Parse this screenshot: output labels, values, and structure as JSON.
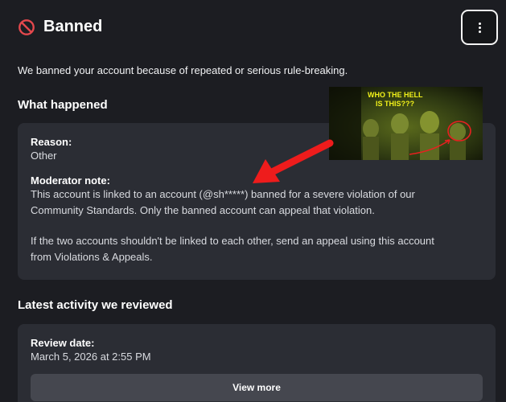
{
  "header": {
    "title": "Banned"
  },
  "intro_text": "We banned your account because of repeated or serious rule-breaking.",
  "what_happened": {
    "heading": "What happened",
    "reason_label": "Reason:",
    "reason_value": "Other",
    "note_label": "Moderator note:",
    "note_line1": "This account is linked to an account (@sh*****) banned for a severe violation of our",
    "note_line2": "Community Standards. Only the banned account can appeal that violation.",
    "note_line3": "If the two accounts shouldn't be linked to each other, send an appeal using this account",
    "note_line4": "from Violations & Appeals."
  },
  "meme": {
    "caption_line1": "WHO THE HELL",
    "caption_line2": "IS THIS???"
  },
  "latest_activity": {
    "heading": "Latest activity we reviewed",
    "review_label": "Review date:",
    "review_value": "March 5, 2026 at 2:55 PM",
    "view_more_label": "View more"
  },
  "colors": {
    "background": "#1c1d22",
    "card": "#2b2d34",
    "ban_icon": "#e5484d",
    "arrow": "#ee1c1c",
    "meme_caption": "#f2f21a"
  }
}
